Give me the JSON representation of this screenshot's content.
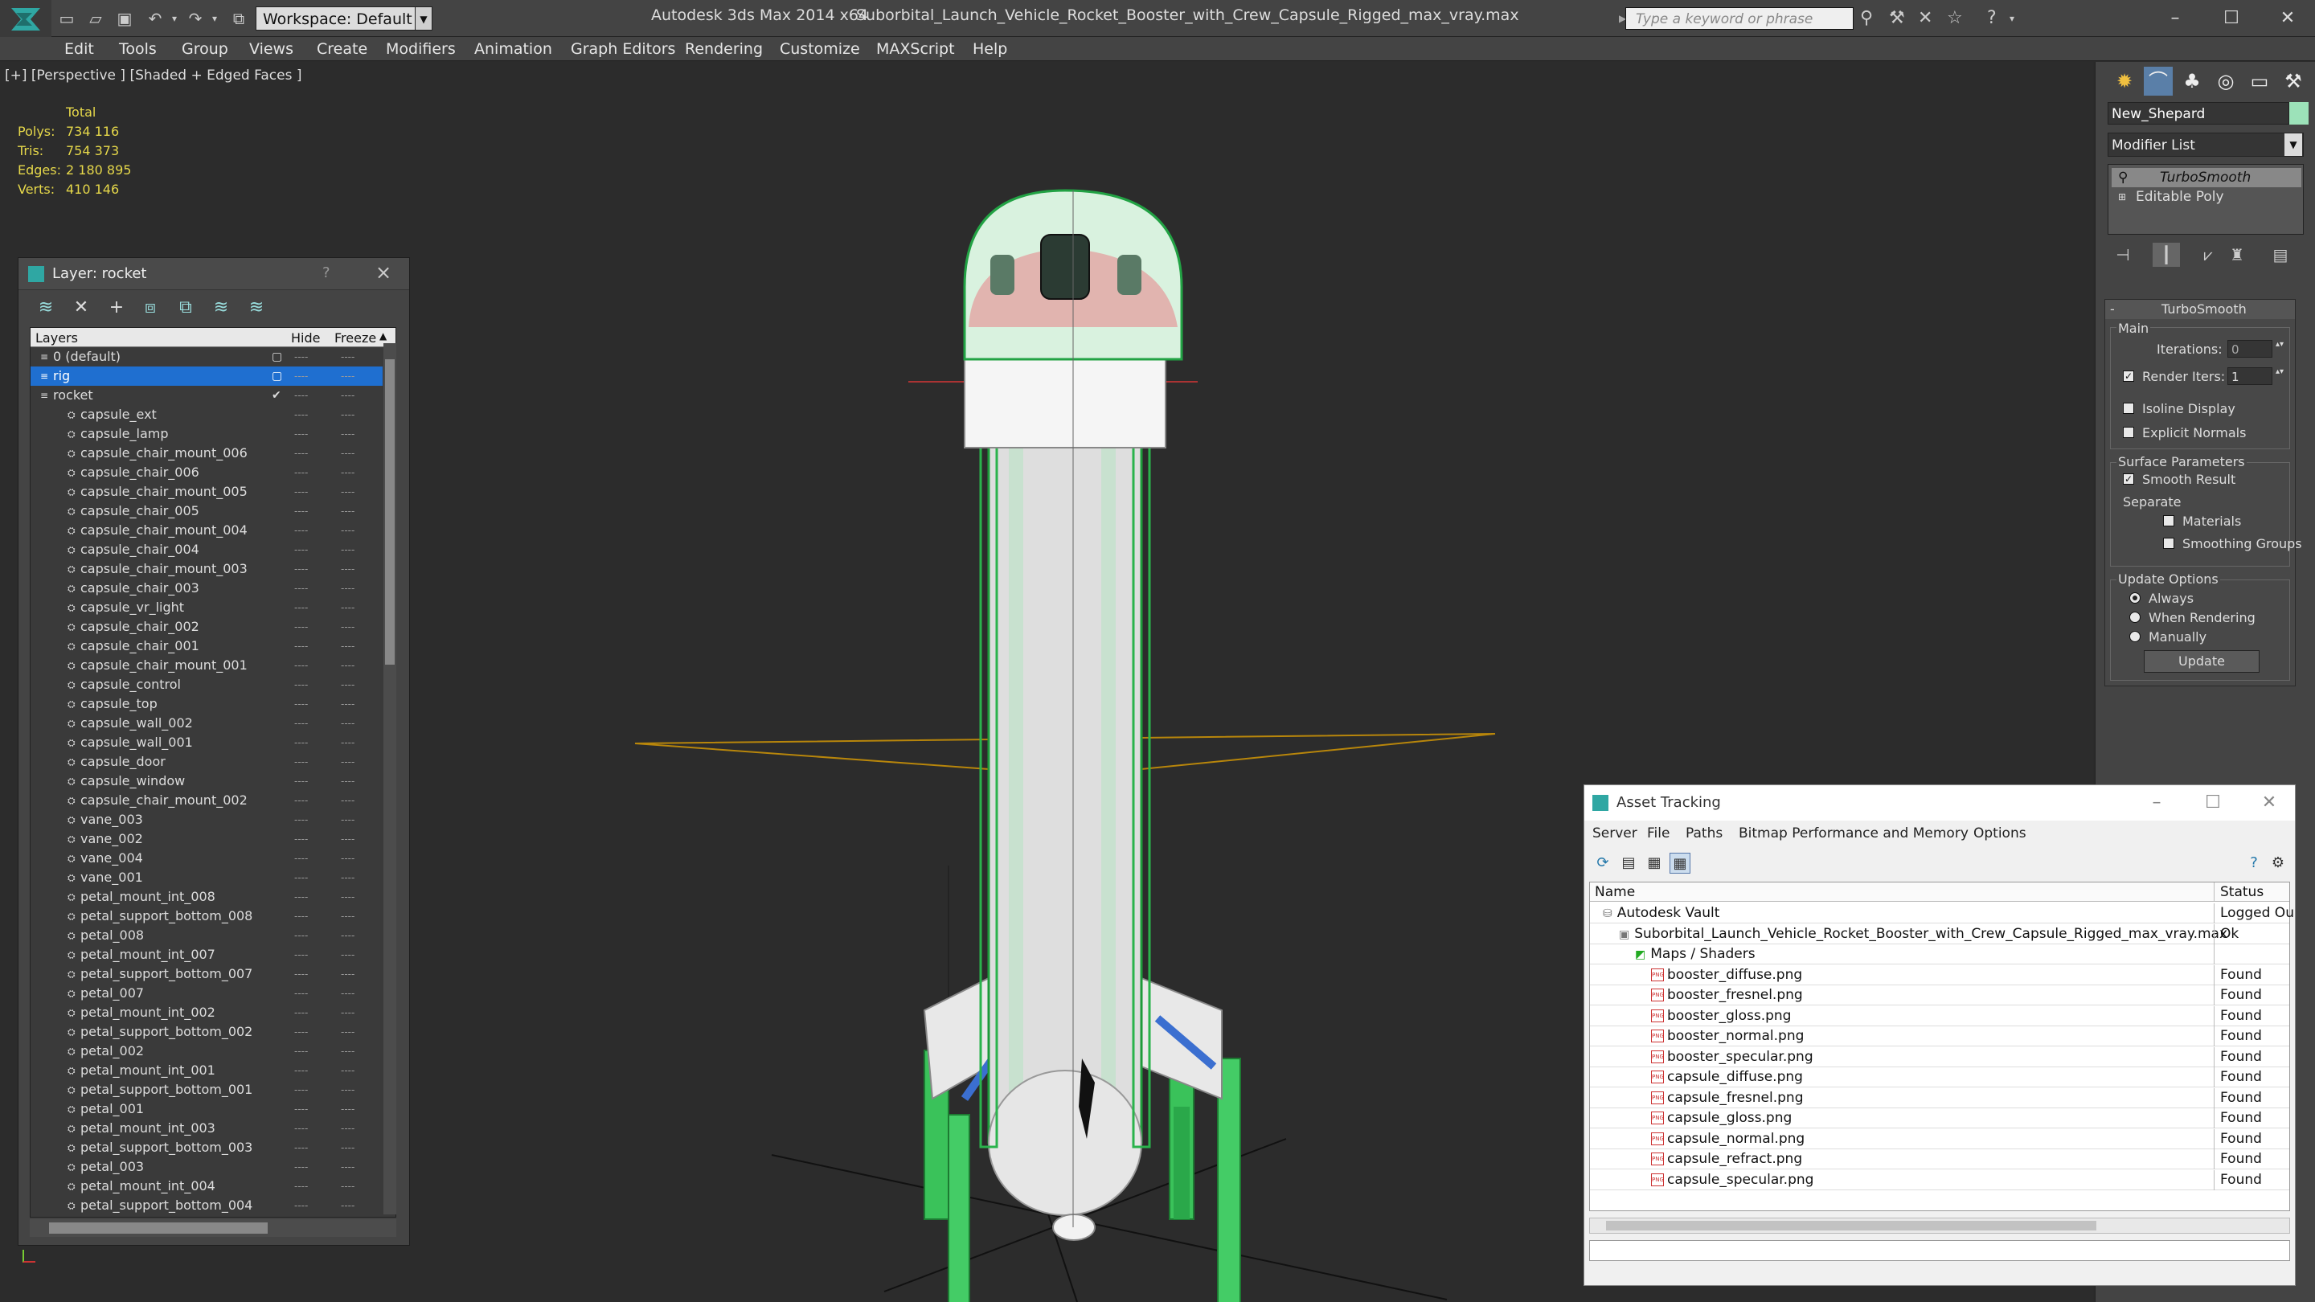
{
  "titlebar": {
    "workspace": "Workspace: Default",
    "app_title": "Autodesk 3ds Max 2014 x64",
    "file_title": "Suborbital_Launch_Vehicle_Rocket_Booster_with_Crew_Capsule_Rigged_max_vray.max",
    "search_placeholder": "Type a keyword or phrase"
  },
  "menubar": [
    "Edit",
    "Tools",
    "Group",
    "Views",
    "Create",
    "Modifiers",
    "Animation",
    "Graph Editors",
    "Rendering",
    "Customize",
    "MAXScript",
    "Help"
  ],
  "viewport": {
    "label": "[+] [Perspective ] [Shaded + Edged Faces ]",
    "stats": {
      "header": "Total",
      "rows": [
        {
          "label": "Polys:",
          "value": "734 116"
        },
        {
          "label": "Tris:",
          "value": "754 373"
        },
        {
          "label": "Edges:",
          "value": "2 180 895"
        },
        {
          "label": "Verts:",
          "value": "410 146"
        }
      ]
    }
  },
  "layer_panel": {
    "title": "Layer: rocket",
    "help": "?",
    "close": "×",
    "headers": {
      "layers": "Layers",
      "hide": "Hide",
      "freeze": "Freeze"
    },
    "layers": [
      {
        "name": "0 (default)",
        "level": 0
      },
      {
        "name": "rig",
        "level": 0,
        "selected": true
      },
      {
        "name": "rocket",
        "level": 0,
        "current": true
      }
    ],
    "objects": [
      "capsule_ext",
      "capsule_lamp",
      "capsule_chair_mount_006",
      "capsule_chair_006",
      "capsule_chair_mount_005",
      "capsule_chair_005",
      "capsule_chair_mount_004",
      "capsule_chair_004",
      "capsule_chair_mount_003",
      "capsule_chair_003",
      "capsule_vr_light",
      "capsule_chair_002",
      "capsule_chair_001",
      "capsule_chair_mount_001",
      "capsule_control",
      "capsule_top",
      "capsule_wall_002",
      "capsule_wall_001",
      "capsule_door",
      "capsule_window",
      "capsule_chair_mount_002",
      "vane_003",
      "vane_002",
      "vane_004",
      "vane_001",
      "petal_mount_int_008",
      "petal_support_bottom_008",
      "petal_008",
      "petal_mount_int_007",
      "petal_support_bottom_007",
      "petal_007",
      "petal_mount_int_002",
      "petal_support_bottom_002",
      "petal_002",
      "petal_mount_int_001",
      "petal_support_bottom_001",
      "petal_001",
      "petal_mount_int_003",
      "petal_support_bottom_003",
      "petal_003",
      "petal_mount_int_004",
      "petal_support_bottom_004"
    ],
    "dash": "----"
  },
  "command_panel": {
    "object_name": "New_Shepard",
    "object_color": "#9ce2b9",
    "modifier_list": "Modifier List",
    "stack": [
      "TurboSmooth",
      "Editable Poly"
    ],
    "rollout_title": "TurboSmooth",
    "main_label": "Main",
    "iterations_label": "Iterations:",
    "iterations_value": "0",
    "render_iters_label": "Render Iters:",
    "render_iters_value": "1",
    "render_iters_checked": true,
    "isoline_label": "Isoline Display",
    "explicit_label": "Explicit Normals",
    "surface_label": "Surface Parameters",
    "smooth_label": "Smooth Result",
    "separate_label": "Separate",
    "materials_label": "Materials",
    "smoothing_groups_label": "Smoothing Groups",
    "update_options_label": "Update Options",
    "always_label": "Always",
    "when_rendering_label": "When Rendering",
    "manually_label": "Manually",
    "update_button": "Update"
  },
  "asset_tracking": {
    "title": "Asset Tracking",
    "menu": [
      "Server",
      "File",
      "Paths",
      "Bitmap Performance and Memory",
      "Options"
    ],
    "headers": {
      "name": "Name",
      "status": "Status"
    },
    "rows": [
      {
        "name": "Autodesk Vault",
        "status": "Logged Ou",
        "level": 0,
        "icon": "vault"
      },
      {
        "name": "Suborbital_Launch_Vehicle_Rocket_Booster_with_Crew_Capsule_Rigged_max_vray.max",
        "status": "Ok",
        "level": 1,
        "icon": "max"
      },
      {
        "name": "Maps / Shaders",
        "status": "",
        "level": 2,
        "icon": "maps"
      },
      {
        "name": "booster_diffuse.png",
        "status": "Found",
        "level": 3,
        "icon": "png"
      },
      {
        "name": "booster_fresnel.png",
        "status": "Found",
        "level": 3,
        "icon": "png"
      },
      {
        "name": "booster_gloss.png",
        "status": "Found",
        "level": 3,
        "icon": "png"
      },
      {
        "name": "booster_normal.png",
        "status": "Found",
        "level": 3,
        "icon": "png"
      },
      {
        "name": "booster_specular.png",
        "status": "Found",
        "level": 3,
        "icon": "png"
      },
      {
        "name": "capsule_diffuse.png",
        "status": "Found",
        "level": 3,
        "icon": "png"
      },
      {
        "name": "capsule_fresnel.png",
        "status": "Found",
        "level": 3,
        "icon": "png"
      },
      {
        "name": "capsule_gloss.png",
        "status": "Found",
        "level": 3,
        "icon": "png"
      },
      {
        "name": "capsule_normal.png",
        "status": "Found",
        "level": 3,
        "icon": "png"
      },
      {
        "name": "capsule_refract.png",
        "status": "Found",
        "level": 3,
        "icon": "png"
      },
      {
        "name": "capsule_specular.png",
        "status": "Found",
        "level": 3,
        "icon": "png"
      }
    ],
    "png_badge": "PNG"
  }
}
